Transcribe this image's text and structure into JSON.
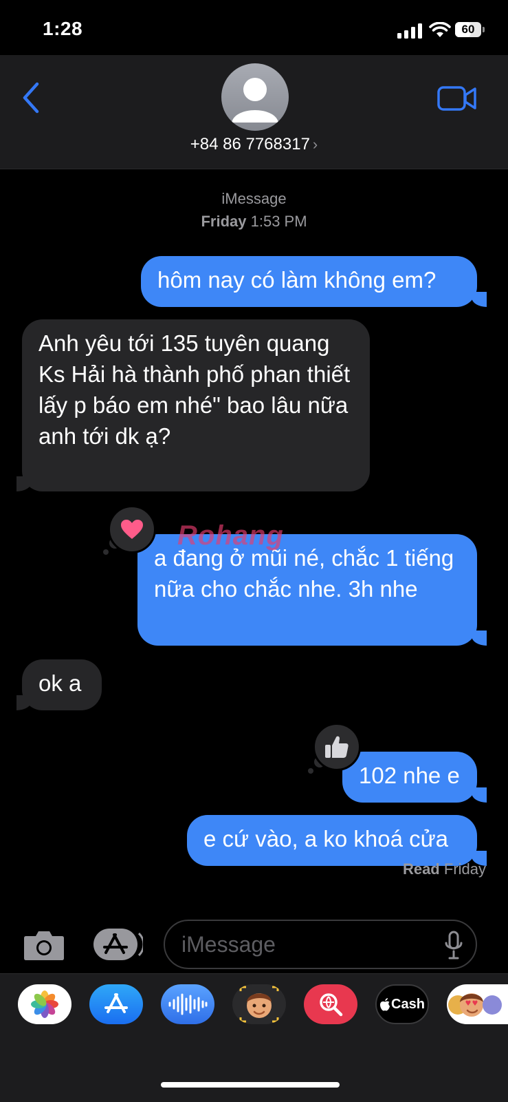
{
  "status_bar": {
    "time": "1:28",
    "battery": "60"
  },
  "header": {
    "contact": "+84 86 7768317"
  },
  "conversation": {
    "service": "iMessage",
    "timestamp_day": "Friday",
    "timestamp_time": "1:53 PM",
    "messages": [
      {
        "direction": "outgoing",
        "text": "hôm nay có làm không em?"
      },
      {
        "direction": "incoming",
        "text": "Anh yêu tới 135 tuyên quang Ks Hải hà thành phố phan thiết lấy p báo em nhé\" bao lâu nữa anh tới dk ạ?"
      },
      {
        "direction": "outgoing",
        "text": "a đang ở mũi né, chắc 1 tiếng nữa cho chắc nhe. 3h nhe",
        "tapback": "heart"
      },
      {
        "direction": "incoming",
        "text": "ok a"
      },
      {
        "direction": "outgoing",
        "text": "102 nhe e",
        "tapback": "thumbs-up"
      },
      {
        "direction": "outgoing",
        "text": "e cứ vào, a ko khoá cửa"
      }
    ],
    "read_label": "Read",
    "read_day": "Friday",
    "watermark": "Rohang"
  },
  "compose": {
    "placeholder": "iMessage"
  },
  "app_drawer": {
    "apps": [
      "photos",
      "app-store",
      "audio-message",
      "memoji",
      "image-search",
      "apple-cash",
      "memoji-stickers"
    ],
    "cash_label": "Cash"
  },
  "colors": {
    "outgoing": "#3e87f7",
    "incoming": "#262628",
    "accent": "#3478f6",
    "header_bg": "#1c1c1e"
  }
}
